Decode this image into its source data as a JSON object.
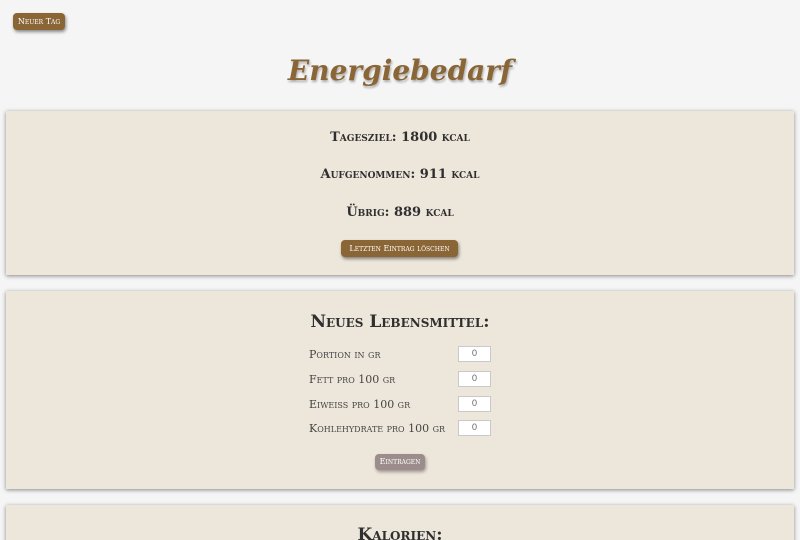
{
  "header": {
    "new_day_label": "Neuer Tag",
    "title": "Energiebedarf"
  },
  "summary": {
    "goal": "Tagesziel: 1800 kcal",
    "taken": "Aufgenommen: 911 kcal",
    "remaining": "Übrig: 889 kcal",
    "delete_label": "Letzten Eintrag löschen"
  },
  "food_form": {
    "heading": "Neues Lebensmittel:",
    "fields": [
      {
        "label": "Portion in gr",
        "placeholder": "0",
        "value": ""
      },
      {
        "label": "Fett pro 100 gr",
        "placeholder": "0",
        "value": ""
      },
      {
        "label": "Eiweiss pro 100 gr",
        "placeholder": "0",
        "value": ""
      },
      {
        "label": "Kohlehydrate pro 100 gr",
        "placeholder": "0",
        "value": ""
      }
    ],
    "submit_label": "Eintragen"
  },
  "calories": {
    "heading": "Kalorien:"
  },
  "colors": {
    "accent": "#8a6536",
    "card_background": "#ede6db",
    "page_background": "#f5f5f5",
    "disabled_button": "#9c8c8c"
  }
}
